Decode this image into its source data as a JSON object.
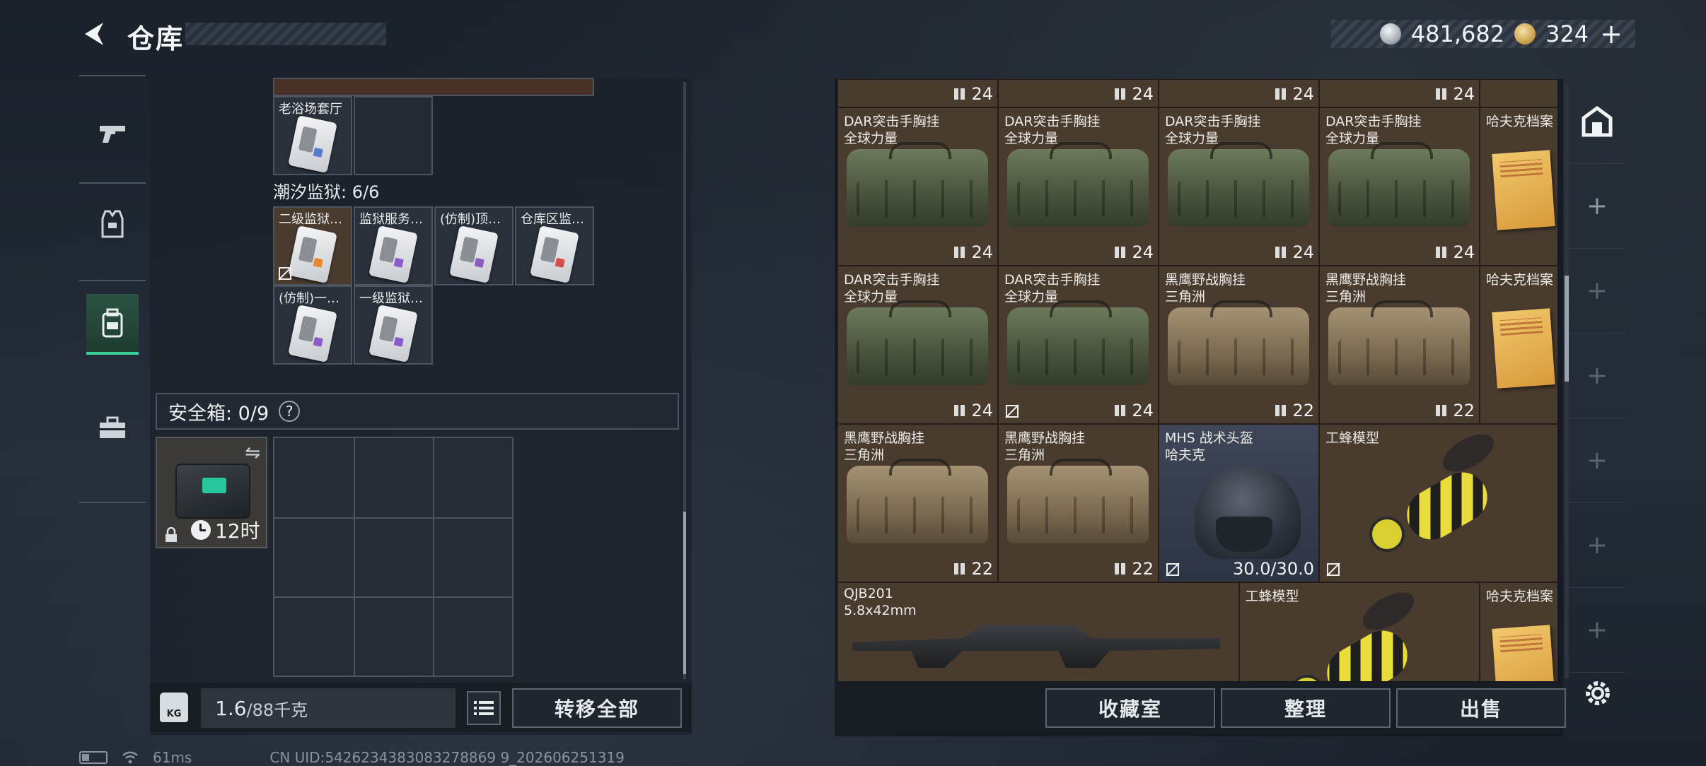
{
  "header": {
    "title": "仓库",
    "currency": [
      {
        "icon": "silver-coin-icon",
        "value": "481,682"
      },
      {
        "icon": "gold-coin-icon",
        "value": "324"
      }
    ],
    "add_label": "+"
  },
  "left_rail": [
    {
      "icon": "pistol-icon",
      "active": false
    },
    {
      "icon": "vest-icon",
      "active": false
    },
    {
      "icon": "backpack-icon",
      "active": true
    },
    {
      "icon": "toolbox-icon",
      "active": false
    }
  ],
  "container": {
    "top_cells": [
      {
        "label": "老浴场套厅",
        "card": "blue"
      },
      {
        "label": "",
        "card": null
      }
    ],
    "section_title": "潮汐监狱: 6/6",
    "prison_cells": [
      {
        "label": "二级监狱…",
        "card": "orange",
        "marked": true
      },
      {
        "label": "监狱服务…",
        "card": "purple",
        "marked": false
      },
      {
        "label": "(仿制)顶…",
        "card": "purple",
        "marked": false
      },
      {
        "label": "仓库区监…",
        "card": "red",
        "marked": false
      },
      {
        "label": "(仿制)一…",
        "card": "purple",
        "marked": false
      },
      {
        "label": "一级监狱…",
        "card": "purple",
        "marked": false
      }
    ]
  },
  "safe": {
    "title": "安全箱: 0/9",
    "help": "?",
    "timer": "12时",
    "swap_icon": "swap-icon"
  },
  "footer_left": {
    "weight_unit_icon": "KG",
    "weight": "1.6",
    "weight_max": "/88千克",
    "transfer_all": "转移全部"
  },
  "stash": {
    "top_row_durability": [
      "24",
      "24",
      "24",
      "24"
    ],
    "items": [
      {
        "name": "DAR突击手胸挂",
        "sub": "全球力量",
        "type": "bag-green",
        "dur": "24",
        "mark": false
      },
      {
        "name": "DAR突击手胸挂",
        "sub": "全球力量",
        "type": "bag-green",
        "dur": "24",
        "mark": false
      },
      {
        "name": "DAR突击手胸挂",
        "sub": "全球力量",
        "type": "bag-green",
        "dur": "24",
        "mark": false
      },
      {
        "name": "DAR突击手胸挂",
        "sub": "全球力量",
        "type": "bag-green",
        "dur": "24",
        "mark": false
      },
      {
        "name": "哈夫克档案",
        "sub": "",
        "type": "folder",
        "dur": "",
        "mark": false
      },
      {
        "name": "DAR突击手胸挂",
        "sub": "全球力量",
        "type": "bag-green",
        "dur": "24",
        "mark": false
      },
      {
        "name": "DAR突击手胸挂",
        "sub": "全球力量",
        "type": "bag-green",
        "dur": "24",
        "mark": true
      },
      {
        "name": "黑鹰野战胸挂",
        "sub": "三角洲",
        "type": "bag-tan",
        "dur": "22",
        "mark": false
      },
      {
        "name": "黑鹰野战胸挂",
        "sub": "三角洲",
        "type": "bag-tan",
        "dur": "22",
        "mark": false
      },
      {
        "name": "哈夫克档案",
        "sub": "",
        "type": "folder",
        "dur": "",
        "mark": false
      },
      {
        "name": "黑鹰野战胸挂",
        "sub": "三角洲",
        "type": "bag-tan",
        "dur": "22",
        "mark": false
      },
      {
        "name": "黑鹰野战胸挂",
        "sub": "三角洲",
        "type": "bag-tan",
        "dur": "22",
        "mark": false
      },
      {
        "name": "MHS 战术头盔",
        "sub": "哈夫克",
        "type": "helmet",
        "dur": "30.0/30.0",
        "mark": true
      },
      {
        "name": "工蜂模型",
        "sub": "",
        "type": "wasp",
        "dur": "",
        "mark": true
      },
      {
        "name": "QJB201",
        "sub": "5.8x42mm",
        "type": "rifle",
        "dur": "",
        "mark": false
      },
      {
        "name": "工蜂模型",
        "sub": "",
        "type": "wasp",
        "dur": "",
        "mark": false
      },
      {
        "name": "哈夫克档案",
        "sub": "",
        "type": "folder",
        "dur": "",
        "mark": false
      }
    ]
  },
  "side_rail": {
    "home_icon": "stash-home-icon",
    "add_slots": [
      "+",
      "+",
      "+",
      "+",
      "+",
      "+"
    ]
  },
  "footer_right": {
    "collection": "收藏室",
    "organize": "整理",
    "sell": "出售"
  },
  "status": {
    "ping": "61ms",
    "uid": "CN UID:5426234383083278869 9_202606251319"
  }
}
